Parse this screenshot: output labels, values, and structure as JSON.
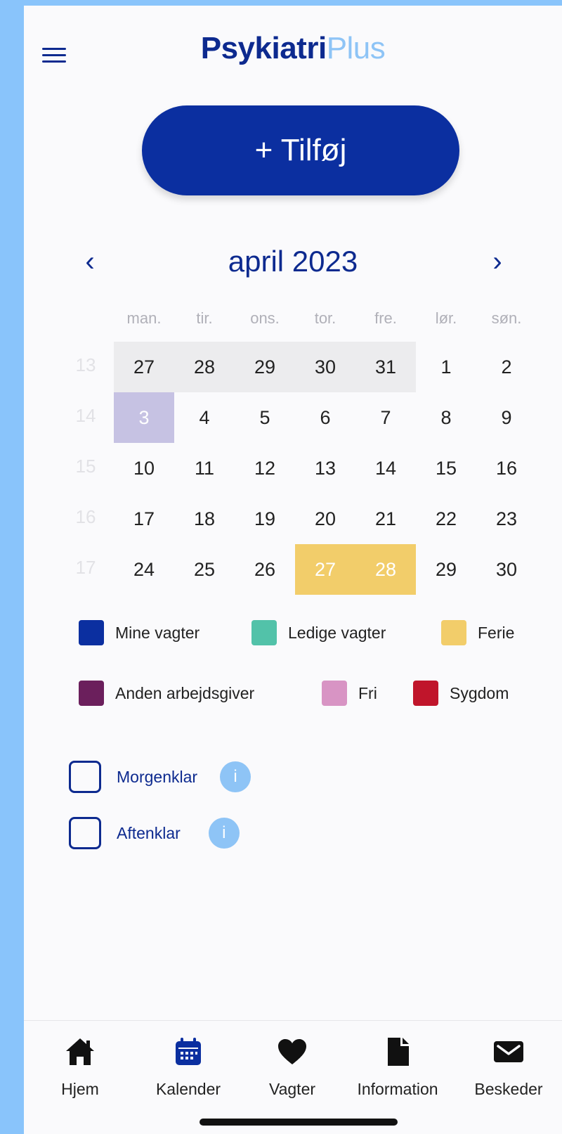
{
  "app": {
    "logo_part1": "Psykiatri",
    "logo_part2": "Plus"
  },
  "add_button": {
    "label": "+ Tilføj"
  },
  "calendar": {
    "month_title": "april 2023",
    "prev_arrow": "‹",
    "next_arrow": "›",
    "weekdays": [
      "man.",
      "tir.",
      "ons.",
      "tor.",
      "fre.",
      "lør.",
      "søn."
    ],
    "weeks": [
      {
        "num": "13",
        "days": [
          "27",
          "28",
          "29",
          "30",
          "31",
          "1",
          "2"
        ]
      },
      {
        "num": "14",
        "days": [
          "3",
          "4",
          "5",
          "6",
          "7",
          "8",
          "9"
        ]
      },
      {
        "num": "15",
        "days": [
          "10",
          "11",
          "12",
          "13",
          "14",
          "15",
          "16"
        ]
      },
      {
        "num": "16",
        "days": [
          "17",
          "18",
          "19",
          "20",
          "21",
          "22",
          "23"
        ]
      },
      {
        "num": "17",
        "days": [
          "24",
          "25",
          "26",
          "27",
          "28",
          "29",
          "30"
        ]
      }
    ],
    "selected_day": "3",
    "vacation_days": [
      "27",
      "28"
    ]
  },
  "legend": {
    "items": [
      {
        "label": "Mine vagter",
        "color": "#0b2fa0"
      },
      {
        "label": "Ledige vagter",
        "color": "#52c2a9"
      },
      {
        "label": "Ferie",
        "color": "#f2cd6a"
      },
      {
        "label": "Anden arbejdsgiver",
        "color": "#6b1f5c"
      },
      {
        "label": "Fri",
        "color": "#d894c4"
      },
      {
        "label": "Sygdom",
        "color": "#c0152b"
      }
    ]
  },
  "options": {
    "morgenklar": "Morgenklar",
    "aftenklar": "Aftenklar",
    "info_glyph": "i"
  },
  "bottom_nav": {
    "items": [
      {
        "label": "Hjem",
        "icon": "home-icon"
      },
      {
        "label": "Kalender",
        "icon": "calendar-icon"
      },
      {
        "label": "Vagter",
        "icon": "heart-icon"
      },
      {
        "label": "Information",
        "icon": "document-icon"
      },
      {
        "label": "Beskeder",
        "icon": "mail-icon"
      }
    ],
    "active_color": "#0b2fa0"
  }
}
